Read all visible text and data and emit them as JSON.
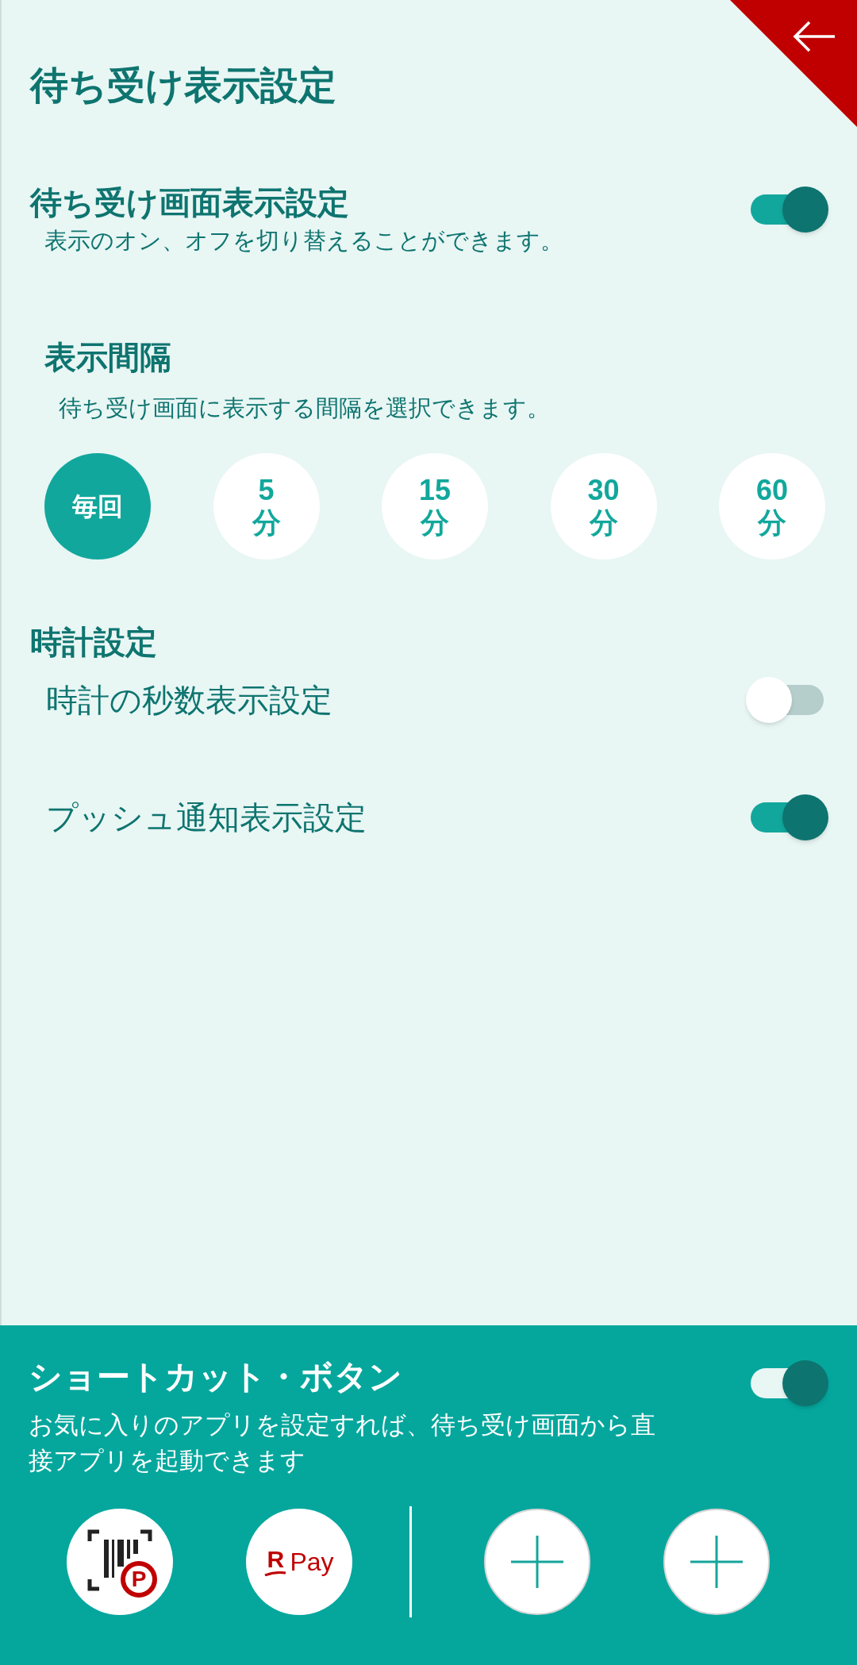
{
  "title": "待ち受け表示設定",
  "standby_display": {
    "title": "待ち受け画面表示設定",
    "description": "表示のオン、オフを切り替えることができます。",
    "on": true
  },
  "interval": {
    "title": "表示間隔",
    "description": "待ち受け画面に表示する間隔を選択できます。",
    "options": [
      {
        "lines": [
          "毎回"
        ],
        "selected": true
      },
      {
        "lines": [
          "5",
          "分"
        ],
        "selected": false
      },
      {
        "lines": [
          "15",
          "分"
        ],
        "selected": false
      },
      {
        "lines": [
          "30",
          "分"
        ],
        "selected": false
      },
      {
        "lines": [
          "60",
          "分"
        ],
        "selected": false
      }
    ]
  },
  "clock": {
    "title": "時計設定",
    "items": [
      {
        "label": "時計の秒数表示設定",
        "on": false
      },
      {
        "label": "プッシュ通知表示設定",
        "on": true
      }
    ]
  },
  "shortcut": {
    "title": "ショートカット・ボタン",
    "description": "お気に入りのアプリを設定すれば、待ち受け画面から直接アプリを起動できます",
    "on": true,
    "apps": [
      {
        "kind": "points",
        "badge": "P"
      },
      {
        "kind": "pay",
        "mark": "R",
        "label": "Pay"
      }
    ],
    "slots": [
      {
        "kind": "add"
      },
      {
        "kind": "add"
      }
    ]
  }
}
